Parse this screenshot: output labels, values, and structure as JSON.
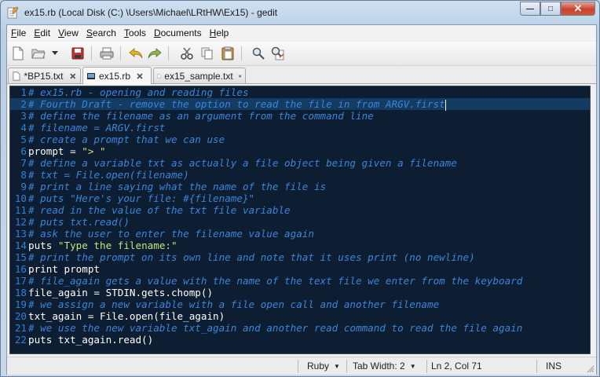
{
  "window": {
    "title": "ex15.rb (Local Disk (C:) \\Users\\Michael\\LRtHW\\Ex15) - gedit",
    "minimize_label": "—",
    "maximize_label": "□",
    "close_label": "✕"
  },
  "menu": {
    "file": {
      "u": "F",
      "rest": "ile"
    },
    "edit": {
      "u": "E",
      "rest": "dit"
    },
    "view": {
      "u": "V",
      "rest": "iew"
    },
    "search": {
      "u": "S",
      "rest": "earch"
    },
    "tools": {
      "u": "T",
      "rest": "ools"
    },
    "documents": {
      "u": "D",
      "rest": "ocuments"
    },
    "help": {
      "u": "H",
      "rest": "elp"
    }
  },
  "toolbar": {
    "icons": [
      "new-document-icon",
      "open-icon",
      "open-dropdown-icon",
      "save-icon",
      "print-icon",
      "undo-icon",
      "redo-icon",
      "cut-icon",
      "copy-icon",
      "paste-icon",
      "find-icon",
      "find-replace-icon"
    ]
  },
  "tabs": [
    {
      "label": "*BP15.txt",
      "active": false
    },
    {
      "label": "ex15.rb",
      "active": true
    },
    {
      "label": "ex15_sample.txt",
      "active": false
    }
  ],
  "editor": {
    "current_line": 2,
    "lines": [
      {
        "n": "1",
        "parts": [
          {
            "t": "# ex15.rb - opening and reading files",
            "k": "c"
          }
        ]
      },
      {
        "n": "2",
        "parts": [
          {
            "t": "# Fourth Draft - remove the option to read the file in from ARGV.first",
            "k": "c"
          }
        ]
      },
      {
        "n": "3",
        "parts": [
          {
            "t": "# define the filename as an argument from the command line",
            "k": "c"
          }
        ]
      },
      {
        "n": "4",
        "parts": [
          {
            "t": "# filename = ARGV.first",
            "k": "c"
          }
        ]
      },
      {
        "n": "5",
        "parts": [
          {
            "t": "# create a prompt that we can use",
            "k": "c"
          }
        ]
      },
      {
        "n": "6",
        "parts": [
          {
            "t": "prompt = ",
            "k": "p"
          },
          {
            "t": "\"> \"",
            "k": "s"
          }
        ]
      },
      {
        "n": "7",
        "parts": [
          {
            "t": "# define a variable txt as actually a file object being given a filename",
            "k": "c"
          }
        ]
      },
      {
        "n": "8",
        "parts": [
          {
            "t": "# txt = File.open(filename)",
            "k": "c"
          }
        ]
      },
      {
        "n": "9",
        "parts": [
          {
            "t": "# print a line saying what the name of the file is",
            "k": "c"
          }
        ]
      },
      {
        "n": "10",
        "parts": [
          {
            "t": "# puts \"Here's your file: #{filename}\"",
            "k": "c"
          }
        ]
      },
      {
        "n": "11",
        "parts": [
          {
            "t": "# read in the value of the txt file variable",
            "k": "c"
          }
        ]
      },
      {
        "n": "12",
        "parts": [
          {
            "t": "# puts txt.read()",
            "k": "c"
          }
        ]
      },
      {
        "n": "13",
        "parts": [
          {
            "t": "# ask the user to enter the filename value again",
            "k": "c"
          }
        ]
      },
      {
        "n": "14",
        "parts": [
          {
            "t": "puts ",
            "k": "p"
          },
          {
            "t": "\"Type the filename:\"",
            "k": "s"
          }
        ]
      },
      {
        "n": "15",
        "parts": [
          {
            "t": "# print the prompt on its own line and note that it uses print (no newline)",
            "k": "c"
          }
        ]
      },
      {
        "n": "16",
        "parts": [
          {
            "t": "print prompt",
            "k": "p"
          }
        ]
      },
      {
        "n": "17",
        "parts": [
          {
            "t": "# file_again gets a value with the name of the text file we enter from the keyboard",
            "k": "c"
          }
        ]
      },
      {
        "n": "18",
        "parts": [
          {
            "t": "file_again = STDIN.gets.chomp()",
            "k": "p"
          }
        ]
      },
      {
        "n": "19",
        "parts": [
          {
            "t": "# we assign a new variable with a file open call and another filename",
            "k": "c"
          }
        ]
      },
      {
        "n": "20",
        "parts": [
          {
            "t": "txt_again = File.open(file_again)",
            "k": "p"
          }
        ]
      },
      {
        "n": "21",
        "parts": [
          {
            "t": "# we use the new variable txt_again and another read command to read the file again",
            "k": "c"
          }
        ]
      },
      {
        "n": "22",
        "parts": [
          {
            "t": "puts txt_again.read()",
            "k": "p"
          }
        ]
      }
    ]
  },
  "status": {
    "language": "Ruby",
    "tab_width": "Tab Width: 2",
    "position": "Ln 2, Col 71",
    "mode": "INS"
  }
}
